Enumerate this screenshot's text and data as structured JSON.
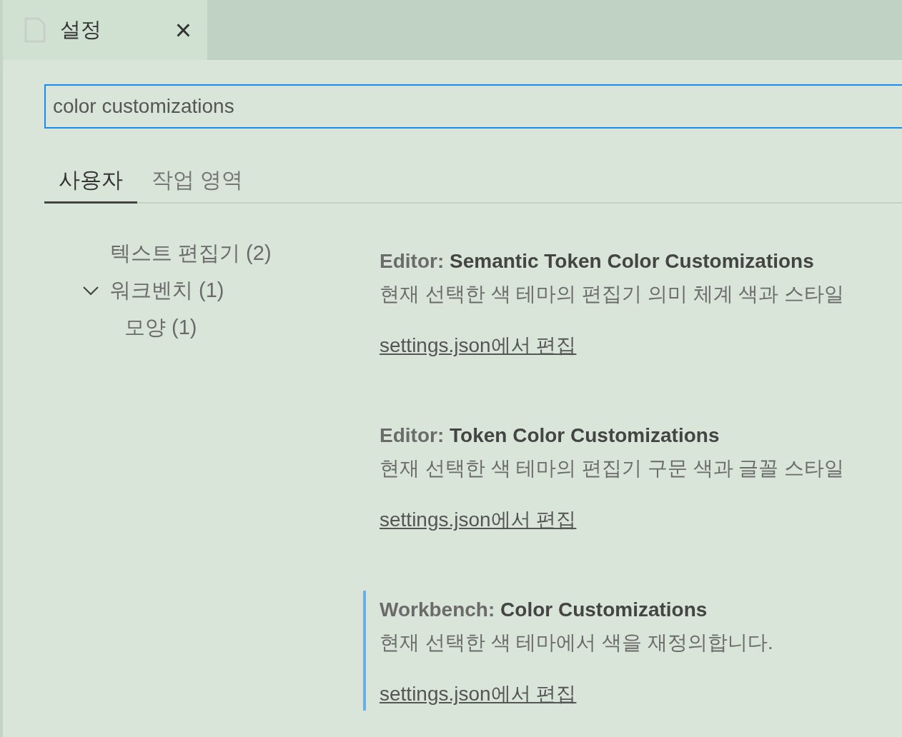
{
  "editor_tab": {
    "title": "설정",
    "close": "×"
  },
  "search": {
    "value": "color customizations"
  },
  "scope_tabs": [
    {
      "label": "사용자",
      "selected": true
    },
    {
      "label": "작업 영역",
      "selected": false
    }
  ],
  "toc": [
    {
      "label": "텍스트 편집기 (2)",
      "expanded": false
    },
    {
      "label": "워크벤치 (1)",
      "expanded": true,
      "children": [
        {
          "label": "모양 (1)"
        }
      ]
    }
  ],
  "settings": [
    {
      "category": "Editor:",
      "label": "Semantic Token Color Customizations",
      "description": "현재 선택한 색 테마의 편집기 의미 체계 색과 스타일",
      "link": "settings.json에서 편집",
      "focused": false
    },
    {
      "category": "Editor:",
      "label": "Token Color Customizations",
      "description": "현재 선택한 색 테마의 편집기 구문 색과 글꼴 스타일",
      "link": "settings.json에서 편집",
      "focused": false
    },
    {
      "category": "Workbench:",
      "label": "Color Customizations",
      "description": "현재 선택한 색 테마에서 색을 재정의합니다.",
      "link": "settings.json에서 편집",
      "focused": true
    }
  ]
}
